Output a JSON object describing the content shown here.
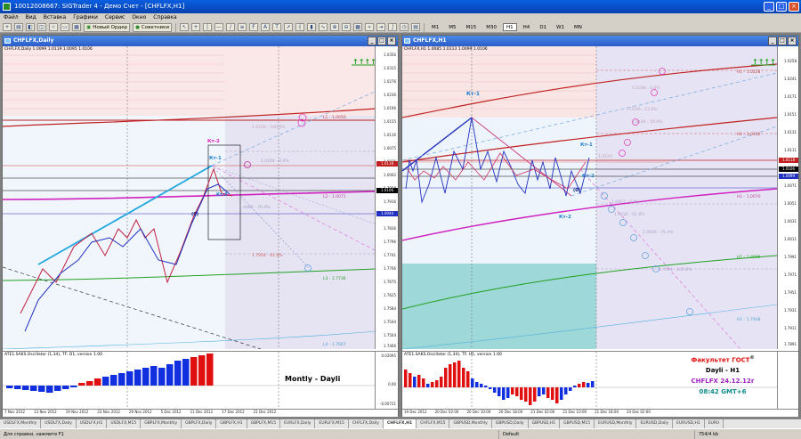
{
  "window": {
    "title": "10012008667: SIGTrader 4 - Демо Счет - [CHFLFX,H1]"
  },
  "menu": [
    "Файл",
    "Вид",
    "Вставка",
    "Графики",
    "Сервис",
    "Окно",
    "Справка"
  ],
  "toolbar": {
    "new_order": "Новый Ордер",
    "advisors": "Советники",
    "timeframes": [
      "M1",
      "M5",
      "M15",
      "M30",
      "H1",
      "H4",
      "D1",
      "W1",
      "MN"
    ],
    "active_timeframe": "H1"
  },
  "left_chart": {
    "title": "CHFLFX,Daily",
    "symbol_line": "CHFLFX,Daily 1.0099 1.0119 1.0095 1.0106",
    "osc_label": "ATE1.SAKS.Oscillator (1,34), TF: D1, version 1.00",
    "center_text": "Montly - Dayli",
    "price_ticks": [
      "1.0356",
      "1.0315",
      "1.0276",
      "1.0236",
      "1.0196",
      "1.0155",
      "1.0116",
      "1.0075",
      "1.0036",
      "1.0002",
      "1.7958",
      "1.7916",
      "1.7876",
      "1.7836",
      "1.7796",
      "1.7741",
      "1.7706",
      "1.7675",
      "1.7625",
      "1.7584",
      "1.7544",
      "1.7504",
      "1.7466"
    ],
    "price_tags": [
      "1.0118",
      "1.0106",
      "1.0044"
    ],
    "osc_ticks": [
      "0.02095",
      "0.00",
      "-0.00721"
    ],
    "dates": [
      "7 Nov 2012",
      "13 Nov 2012",
      "19 Nov 2012",
      "23 Nov 2012",
      "29 Nov 2012",
      "5 Dec 2012",
      "11 Dec 2012",
      "17 Dec 2012",
      "21 Dec 2012"
    ],
    "labels": {
      "kt2": "Кт-2",
      "kt1": "Кт-1",
      "kt3": "Кт-3",
      "p0": "(0)",
      "l1": "L1 - 1.0050",
      "l2": "L2 - 1.0071",
      "l3": "L3 - 1.7736",
      "l4": "L4 - 1.7667",
      "f1": "1.0164 - 0.0%",
      "f2": "1.0086 - 76.4%",
      "f3": "1.7954 - 61.8%",
      "f4": "1.0116 - 100.0%",
      "arrows": "↑↑↑↑"
    }
  },
  "right_chart": {
    "title": "CHFLFX,H1",
    "symbol_line": "CHFLFX,H1 1.0085 1.0113 1.0099 1.0106",
    "osc_label": "ATE1.SAKS.Oscillator (1,34), TF: H1, version 1.00",
    "price_ticks": [
      "1.0258",
      "1.0241",
      "1.0171",
      "1.0151",
      "1.0131",
      "1.0111",
      "1.0091",
      "1.0071",
      "1.0051",
      "1.0031",
      "1.0011",
      "1.7991",
      "1.7971",
      "1.7951",
      "1.7931",
      "1.7911",
      "1.7891"
    ],
    "price_tags": [
      "1.0118",
      "1.0106",
      "1.0099"
    ],
    "dates": [
      "19 Dec 2012",
      "20 Dec 02:00",
      "20 Dec 10:00",
      "20 Dec 18:00",
      "21 Dec 02:00",
      "21 Dec 10:00",
      "21 Dec 18:00",
      "24 Dec 02:00"
    ],
    "labels": {
      "kt1": "Кт-1",
      "kt1b": "Кт-1",
      "kt2": "Кт-2",
      "kt2b": "Кт-2",
      "p0": "(0)",
      "h1": "H1 - 1.0228",
      "h2": "H1 - 1.0132",
      "h3": "H1 - 1.0070",
      "h4": "H1 - 1.0006",
      "h5": "H1 - 1.7938",
      "f1": "1.0208 - 0.0%",
      "f2": "1.0166 - 23.6%",
      "f3": "1.0144 - 50.0%",
      "f4": "1.0120",
      "f5": "1.0067 - 0.0%",
      "f6": "1.0035 - 61.8%",
      "f7": "1.0026 - 76.4%",
      "f8": "1.7994 - 100.0%",
      "arrows": "↑↑↑↑"
    },
    "info": {
      "line1": "Факультет ГОСТ",
      "sup": "©",
      "line2": "Dayli - H1",
      "line3": "CHFLFX 24.12.12г",
      "line4": "08:42 GMT+6"
    }
  },
  "sheet_tabs": [
    "USDLFX,Monthly",
    "USDLFX,Daily",
    "USDLFX,H1",
    "USDLFX,M15",
    "GBPLFX,Monthly",
    "GBPLFX,Daily",
    "GBPLFX,H1",
    "GBPLFX,M15",
    "EURLFX,Daily",
    "EURLFX,M15",
    "CHFLFX,Daily",
    "CHFLFX,H1",
    "CHFLFX,M15",
    "GBPUSD,Monthly",
    "GBPUSD,Daily",
    "GBPUSD,H1",
    "GBPUSD,M15",
    "EURUSD,Monthly",
    "EURUSD,Daily",
    "EURUSD,H1",
    "EURU"
  ],
  "active_sheet_tab": "CHFLFX,H1",
  "status": {
    "help": "Для справки, нажмите F1",
    "profile": "Default",
    "traffic": "754/4 kb"
  },
  "colors": {
    "accent": "#0a5ee0",
    "red_bar": "#e01010",
    "blue_bar": "#1030e0",
    "info_red": "#e01010",
    "info_purple": "#a020c0",
    "info_teal": "#0a8a8a"
  }
}
